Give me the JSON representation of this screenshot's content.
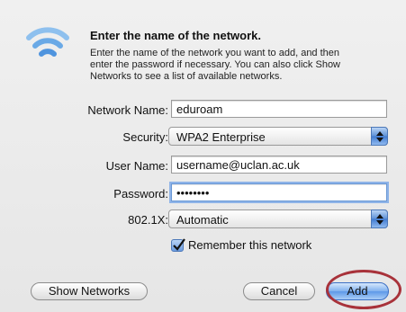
{
  "dialog": {
    "icon": "wifi-icon",
    "title": "Enter the name of the network.",
    "description": "Enter the name of the network you want to add, and then enter the password if necessary. You can also click Show Networks to see a list of available networks."
  },
  "form": {
    "network_name": {
      "label": "Network Name:",
      "value": "eduroam"
    },
    "security": {
      "label": "Security:",
      "value": "WPA2 Enterprise"
    },
    "user_name": {
      "label": "User Name:",
      "value": "username@uclan.ac.uk"
    },
    "password": {
      "label": "Password:",
      "value": "••••••••"
    },
    "eap": {
      "label": "802.1X:",
      "value": "Automatic"
    },
    "remember": {
      "label": "Remember this network",
      "checked": true
    }
  },
  "buttons": {
    "show_networks": "Show Networks",
    "cancel": "Cancel",
    "add": "Add"
  },
  "colors": {
    "accent": "#5d98e8",
    "highlight_ring": "#a8323a"
  }
}
